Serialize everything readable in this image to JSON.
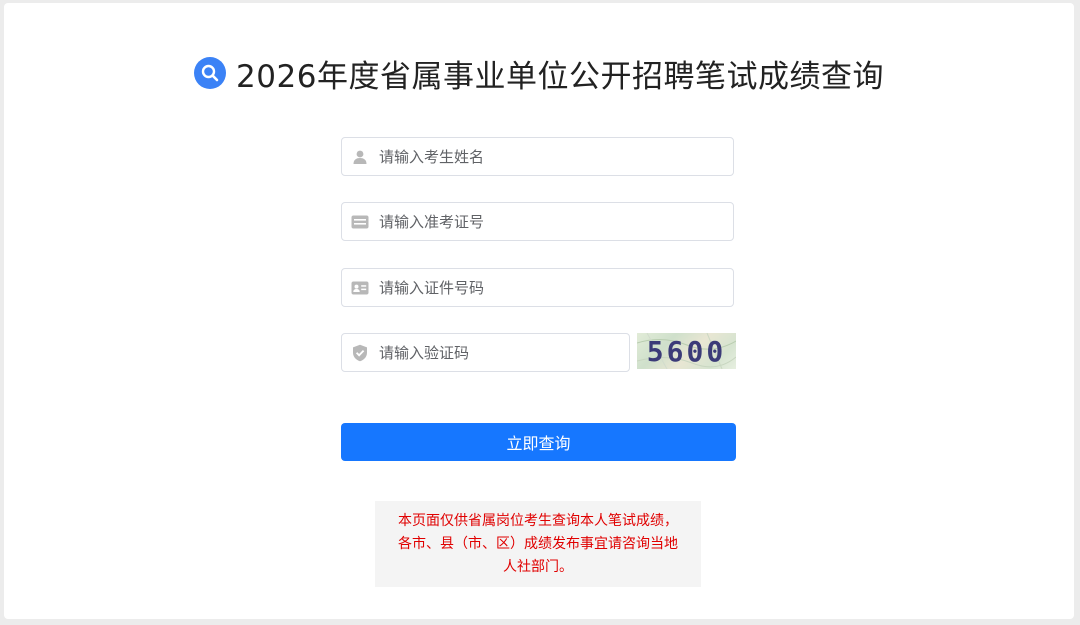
{
  "page": {
    "title": "2026年度省属事业单位公开招聘笔试成绩查询"
  },
  "form": {
    "name_placeholder": "请输入考生姓名",
    "ticket_placeholder": "请输入准考证号",
    "id_placeholder": "请输入证件号码",
    "captcha_placeholder": "请输入验证码",
    "captcha_text": "5600",
    "submit_label": "立即查询"
  },
  "notice": {
    "lines": [
      "本页面仅供省属岗位考生查询本人笔试成绩，",
      "各市、县（市、区）成绩发布事宜请咨询当地",
      "人社部门。"
    ]
  },
  "colors": {
    "primary": "#1677ff",
    "notice_text": "#e00000",
    "title_icon": "#3b82f6"
  },
  "icons": {
    "title": "search-icon",
    "name": "user-icon",
    "ticket": "card-icon",
    "id": "id-card-icon",
    "captcha": "shield-check-icon"
  }
}
